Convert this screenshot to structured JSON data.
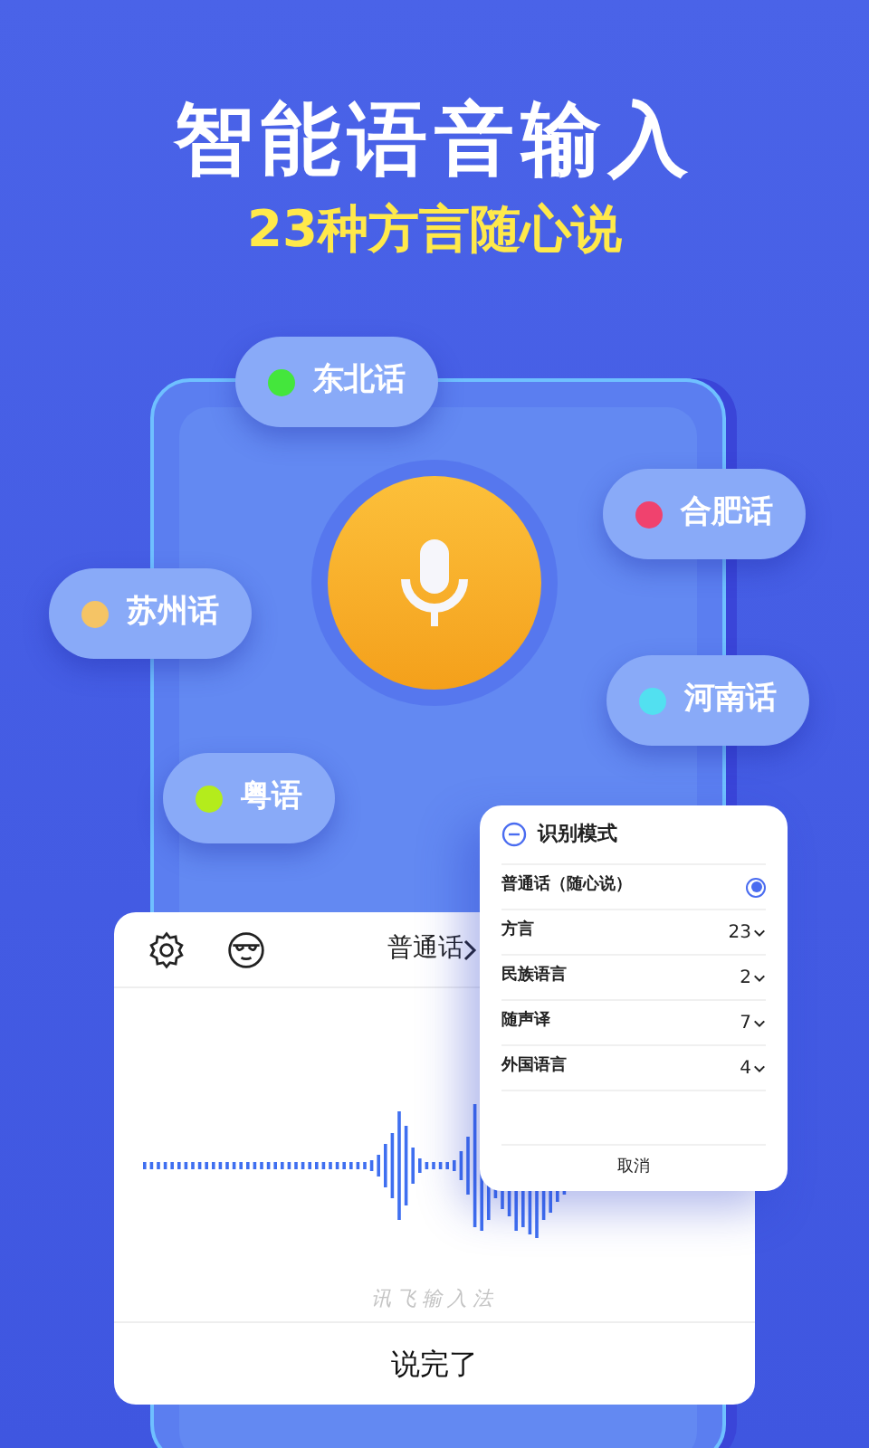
{
  "headline": "智能语音输入",
  "subtitle": "23种方言随心说",
  "dialect_chips": [
    {
      "label": "东北话",
      "color": "#44e63c"
    },
    {
      "label": "合肥话",
      "color": "#f0426e"
    },
    {
      "label": "苏州话",
      "color": "#f5c465"
    },
    {
      "label": "河南话",
      "color": "#52e0f0"
    },
    {
      "label": "粤语",
      "color": "#b4ec1c"
    }
  ],
  "voice_panel": {
    "language": "普通话",
    "brand": "讯飞输入法",
    "done_button": "说完了"
  },
  "mode_popup": {
    "title": "识别模式",
    "options": [
      {
        "kind": "radio",
        "label": "普通话（随心说）",
        "selected": true
      },
      {
        "kind": "count",
        "label": "方言",
        "count": "23"
      },
      {
        "kind": "count",
        "label": "民族语言",
        "count": "2"
      },
      {
        "kind": "count",
        "label": "随声译",
        "count": "7"
      },
      {
        "kind": "count",
        "label": "外国语言",
        "count": "4"
      }
    ],
    "cancel": "取消"
  }
}
